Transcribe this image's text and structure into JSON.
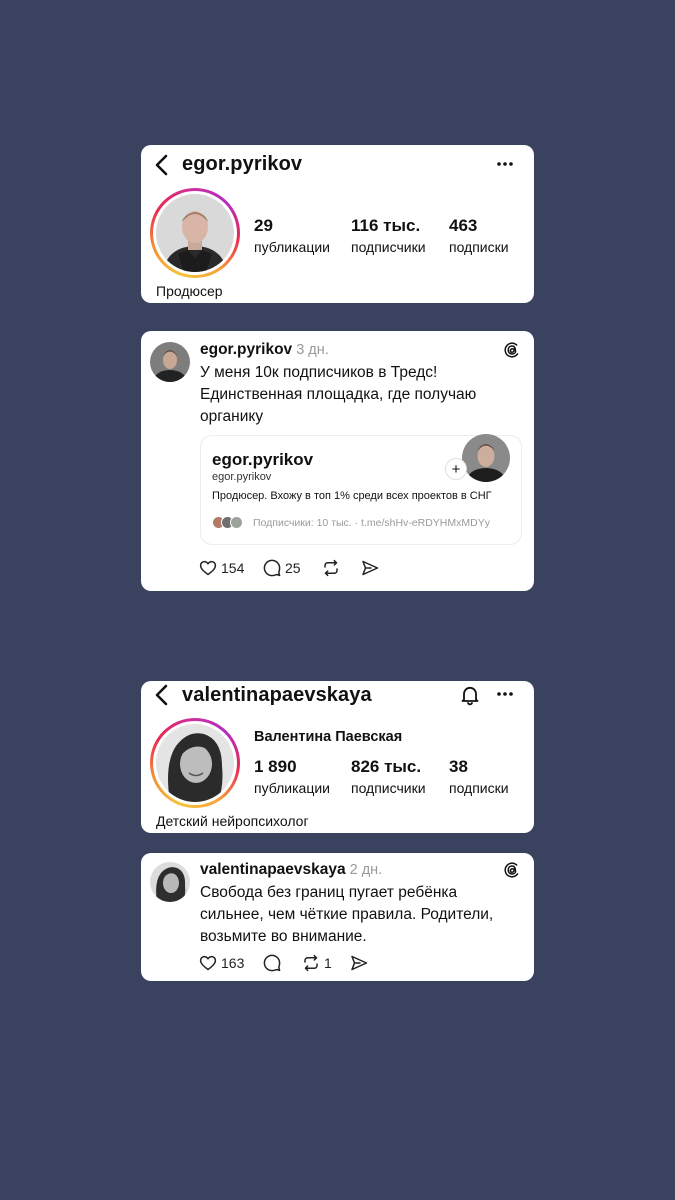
{
  "colors": {
    "background": "#3a4260",
    "card": "#ffffff",
    "muted": "#9a9a9a"
  },
  "profile1": {
    "username": "egor.pyrikov",
    "stats": [
      {
        "value": "29",
        "label": "публикации"
      },
      {
        "value": "116 тыс.",
        "label": "подписчики"
      },
      {
        "value": "463",
        "label": "подписки"
      }
    ],
    "bio": "Продюсер",
    "icons": [
      "back-arrow-icon",
      "more-icon"
    ]
  },
  "post1": {
    "username": "egor.pyrikov",
    "time": "3 дн.",
    "text_lines": [
      "У меня 10к подписчиков в Тредс!",
      "Единственная площадка, где получаю",
      "органику"
    ],
    "embed": {
      "username": "egor.pyrikov",
      "handle": "egor.pyrikov",
      "bio": "Продюсер. Вхожу в топ 1% среди всех проектов в СНГ",
      "meta": "Подписчики: 10 тыс. · t.me/shHv-eRDYHMxMDYy",
      "plus": "+"
    },
    "actions": {
      "likes": "154",
      "comments": "25"
    }
  },
  "profile2": {
    "username": "valentinapaevskaya",
    "full_name": "Валентина Паевская",
    "stats": [
      {
        "value": "1 890",
        "label": "публикации"
      },
      {
        "value": "826 тыс.",
        "label": "подписчики"
      },
      {
        "value": "38",
        "label": "подписки"
      }
    ],
    "bio": "Детский нейропсихолог",
    "icons": [
      "back-arrow-icon",
      "bell-icon",
      "more-icon"
    ]
  },
  "post2": {
    "username": "valentinapaevskaya",
    "time": "2 дн.",
    "text_lines": [
      "Свобода без границ пугает ребёнка",
      "сильнее, чем чёткие правила. Родители,",
      "возьмите во внимание."
    ],
    "actions": {
      "likes": "163",
      "reposts": "1"
    }
  }
}
